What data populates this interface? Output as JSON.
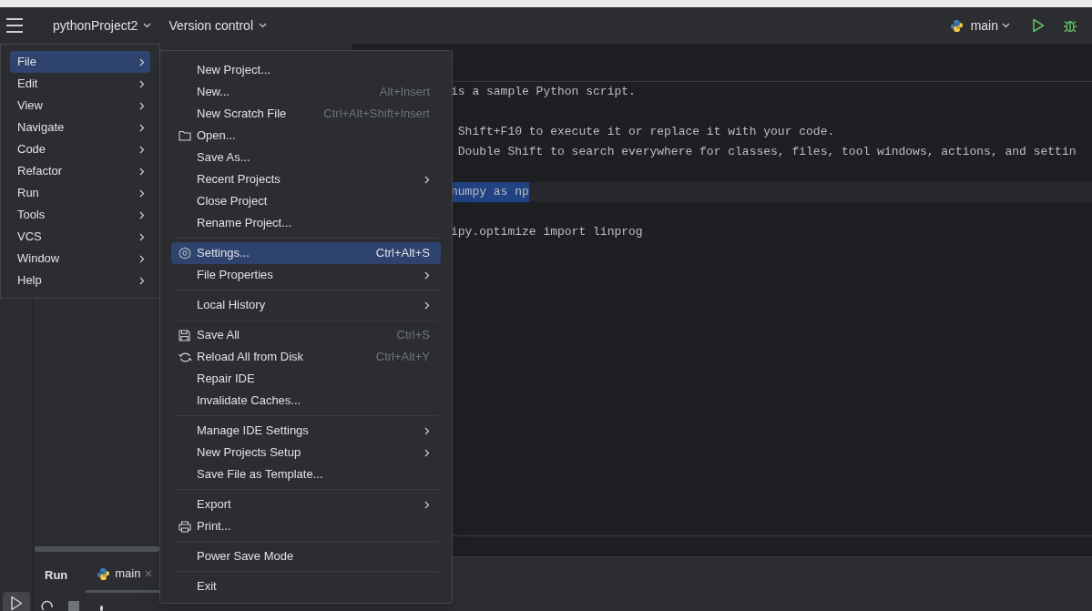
{
  "title_bar": {
    "project": "pythonProject2",
    "vcs": "Version control",
    "run_config": "main"
  },
  "main_menu": [
    {
      "label": "File",
      "has_submenu": true,
      "selected": true
    },
    {
      "label": "Edit",
      "has_submenu": true,
      "selected": false
    },
    {
      "label": "View",
      "has_submenu": true,
      "selected": false
    },
    {
      "label": "Navigate",
      "has_submenu": true,
      "selected": false
    },
    {
      "label": "Code",
      "has_submenu": true,
      "selected": false
    },
    {
      "label": "Refactor",
      "has_submenu": true,
      "selected": false
    },
    {
      "label": "Run",
      "has_submenu": true,
      "selected": false
    },
    {
      "label": "Tools",
      "has_submenu": true,
      "selected": false
    },
    {
      "label": "VCS",
      "has_submenu": true,
      "selected": false
    },
    {
      "label": "Window",
      "has_submenu": true,
      "selected": false
    },
    {
      "label": "Help",
      "has_submenu": true,
      "selected": false
    }
  ],
  "file_menu": [
    {
      "kind": "item",
      "label": "New Project...",
      "has_submenu": false,
      "selected": false
    },
    {
      "kind": "item",
      "label": "New...",
      "shortcut": "Alt+Insert",
      "has_submenu": false,
      "selected": false
    },
    {
      "kind": "item",
      "label": "New Scratch File",
      "shortcut": "Ctrl+Alt+Shift+Insert",
      "has_submenu": false,
      "selected": false
    },
    {
      "kind": "item",
      "label": "Open...",
      "has_submenu": false,
      "selected": false
    },
    {
      "kind": "item",
      "label": "Save As...",
      "has_submenu": false,
      "selected": false
    },
    {
      "kind": "item",
      "label": "Recent Projects",
      "has_submenu": true,
      "selected": false
    },
    {
      "kind": "item",
      "label": "Close Project",
      "has_submenu": false,
      "selected": false
    },
    {
      "kind": "item",
      "label": "Rename Project...",
      "has_submenu": false,
      "selected": false
    },
    {
      "kind": "separator"
    },
    {
      "kind": "item",
      "label": "Settings...",
      "shortcut": "Ctrl+Alt+S",
      "has_submenu": false,
      "selected": true
    },
    {
      "kind": "item",
      "label": "File Properties",
      "has_submenu": true,
      "selected": false
    },
    {
      "kind": "separator"
    },
    {
      "kind": "item",
      "label": "Local History",
      "has_submenu": true,
      "selected": false
    },
    {
      "kind": "separator"
    },
    {
      "kind": "item",
      "label": "Save All",
      "shortcut": "Ctrl+S",
      "has_submenu": false,
      "selected": false
    },
    {
      "kind": "item",
      "label": "Reload All from Disk",
      "shortcut": "Ctrl+Alt+Y",
      "has_submenu": false,
      "selected": false
    },
    {
      "kind": "item",
      "label": "Repair IDE",
      "has_submenu": false,
      "selected": false
    },
    {
      "kind": "item",
      "label": "Invalidate Caches...",
      "has_submenu": false,
      "selected": false
    },
    {
      "kind": "separator"
    },
    {
      "kind": "item",
      "label": "Manage IDE Settings",
      "has_submenu": true,
      "selected": false
    },
    {
      "kind": "item",
      "label": "New Projects Setup",
      "has_submenu": true,
      "selected": false
    },
    {
      "kind": "item",
      "label": "Save File as Template...",
      "has_submenu": false,
      "selected": false
    },
    {
      "kind": "separator"
    },
    {
      "kind": "item",
      "label": "Export",
      "has_submenu": true,
      "selected": false
    },
    {
      "kind": "item",
      "label": "Print...",
      "has_submenu": false,
      "selected": false
    },
    {
      "kind": "separator"
    },
    {
      "kind": "item",
      "label": "Power Save Mode",
      "has_submenu": false,
      "selected": false
    },
    {
      "kind": "separator"
    },
    {
      "kind": "item",
      "label": "Exit",
      "has_submenu": false,
      "selected": false
    }
  ],
  "editor_lines": [
    {
      "kind": "code",
      "text": "is a sample Python script.",
      "highlighted": false
    },
    {
      "kind": "blank"
    },
    {
      "kind": "code",
      "text": " Shift+F10 to execute it or replace it with your code.",
      "highlighted": false
    },
    {
      "kind": "code",
      "text": " Double Shift to search everywhere for classes, files, tool windows, actions, and settin",
      "highlighted": false
    },
    {
      "kind": "blank"
    },
    {
      "kind": "code",
      "text": "numpy as np",
      "highlighted": true
    },
    {
      "kind": "blank"
    },
    {
      "kind": "code",
      "text": "ipy.optimize import linprog",
      "highlighted": false
    }
  ],
  "run_panel": {
    "title": "Run",
    "tabs": [
      {
        "label": "main",
        "selected": true
      }
    ]
  }
}
